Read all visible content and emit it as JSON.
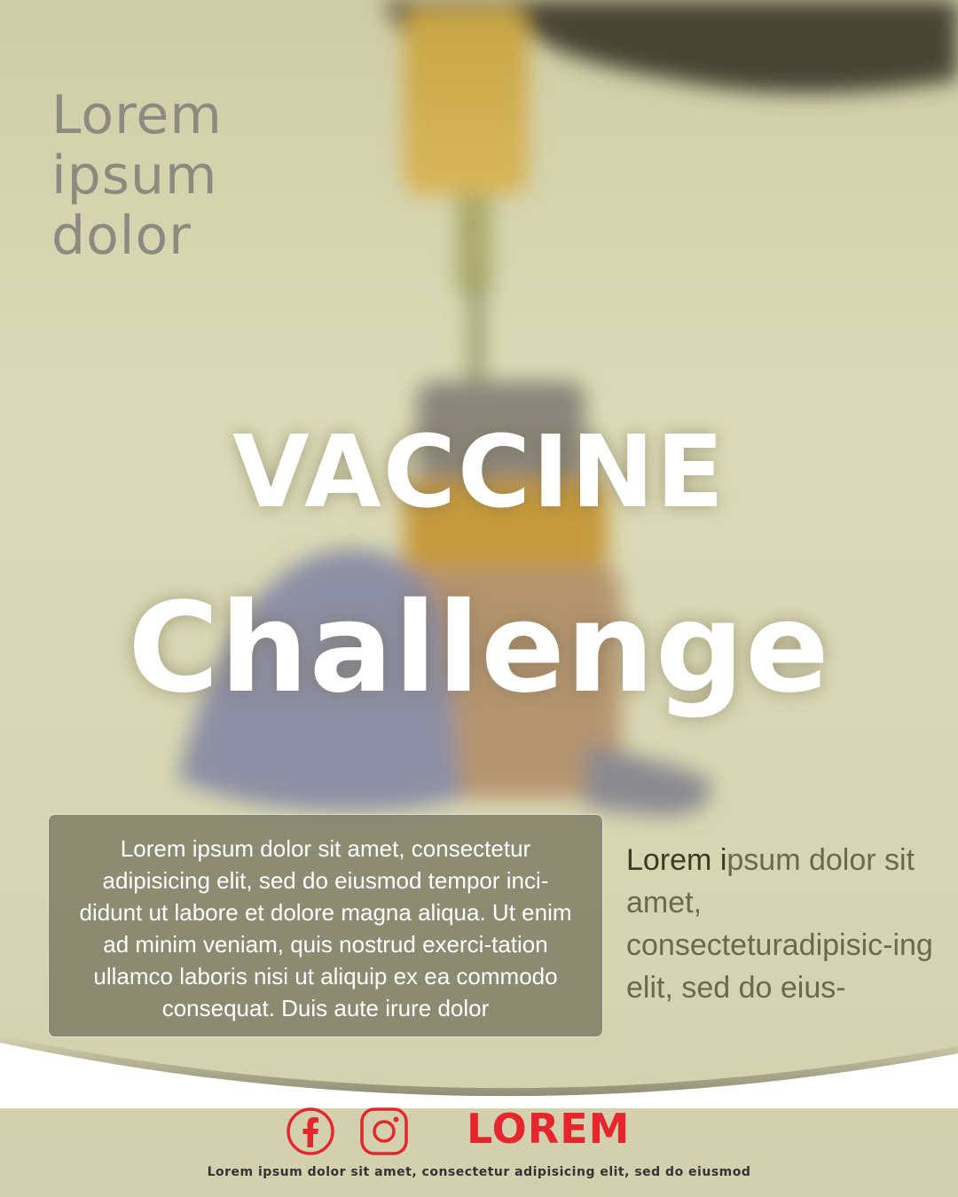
{
  "top_title": {
    "line1": "Lorem",
    "line2": "ipsum",
    "line3": "dolor"
  },
  "headline": {
    "line1": "VACCINE",
    "line2": "Challenge"
  },
  "info_box": {
    "text": "Lorem ipsum dolor sit amet, consectetur adipisicing elit, sed do eiusmod tempor inci-didunt ut labore et dolore magna aliqua. Ut enim ad minim veniam, quis nostrud exerci-tation ullamco laboris nisi ut aliquip ex ea commodo consequat. Duis aute irure dolor"
  },
  "side_text": {
    "emphasis": "Lorem i",
    "rest": "psum dolor sit amet, consecteturadipisic-ing elit, sed do eius-"
  },
  "footer": {
    "brand": "LOREM",
    "note": "Lorem ipsum dolor sit amet, consectetur adipisicing elit, sed do eiusmod",
    "icons": [
      "facebook-icon",
      "instagram-icon"
    ],
    "accent_color": "#e5272d"
  }
}
